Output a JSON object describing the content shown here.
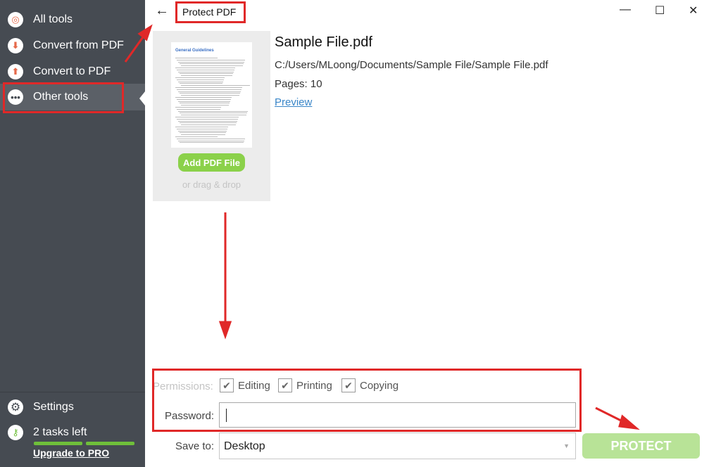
{
  "sidebar": {
    "items": [
      {
        "label": "All tools",
        "icon": "spiral-icon"
      },
      {
        "label": "Convert from PDF",
        "icon": "arrow-down-icon"
      },
      {
        "label": "Convert to PDF",
        "icon": "arrow-up-icon"
      },
      {
        "label": "Other tools",
        "icon": "more-icon",
        "selected": true
      }
    ],
    "settings": "Settings",
    "tasks_left": "2 tasks left",
    "tasks_remaining": 2,
    "tasks_total": 2,
    "upgrade": "Upgrade to PRO"
  },
  "header": {
    "title": "Protect PDF",
    "back": "←",
    "minimize": "—",
    "maximize": "☐",
    "close": "✕"
  },
  "file": {
    "thumb_heading": "General Guidelines",
    "add_button": "Add PDF File",
    "drag_hint": "or drag & drop",
    "name": "Sample File.pdf",
    "path": "C:/Users/MLoong/Documents/Sample File/Sample File.pdf",
    "pages": "Pages: 10",
    "preview": "Preview"
  },
  "form": {
    "permissions_label": "Permissions:",
    "editing": "Editing",
    "printing": "Printing",
    "copying": "Copying",
    "check": "✔",
    "password_label": "Password:",
    "password_value": "",
    "save_label": "Save to:",
    "save_value": "Desktop",
    "protect": "PROTECT"
  },
  "colors": {
    "sidebar": "#464b52",
    "accent_green": "#8bd14a",
    "annotation_red": "#e02828"
  }
}
